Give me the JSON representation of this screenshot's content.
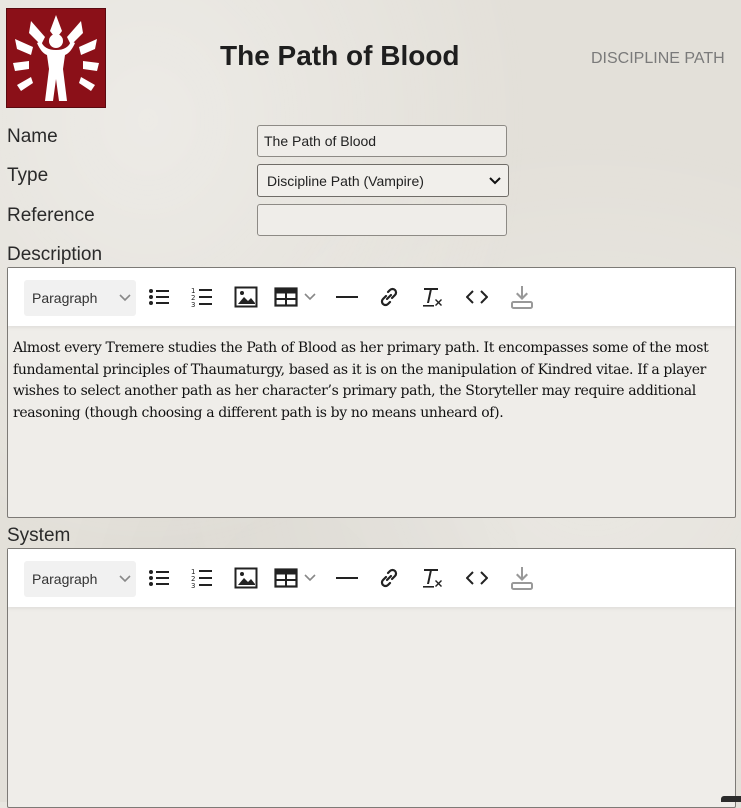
{
  "header": {
    "title": "The Path of Blood",
    "doc_type": "DISCIPLINE PATH",
    "logo_icon": "vampire-figure-flames-icon",
    "logo_color": "#8b1018"
  },
  "form": {
    "name_label": "Name",
    "name_value": "The Path of Blood",
    "type_label": "Type",
    "type_value": "Discipline Path (Vampire)",
    "reference_label": "Reference",
    "reference_value": "",
    "description_label": "Description",
    "system_label": "System"
  },
  "description_editor": {
    "block_format": "Paragraph",
    "toolbar_icons": [
      "bullet-list-icon",
      "numbered-list-icon",
      "image-icon",
      "table-icon",
      "horizontal-rule-icon",
      "link-icon",
      "clear-format-icon",
      "code-icon",
      "download-icon"
    ],
    "content": "Almost every Tremere studies the Path of Blood as her primary path. It encompasses some of the most fundamental principles of Thaumaturgy, based as it is on the manipulation of Kindred vitae. If a player wishes to select another path as her character’s primary path, the Storyteller may require additional reasoning (though choosing a different path is by no means unheard of)."
  },
  "system_editor": {
    "block_format": "Paragraph",
    "toolbar_icons": [
      "bullet-list-icon",
      "numbered-list-icon",
      "image-icon",
      "table-icon",
      "horizontal-rule-icon",
      "link-icon",
      "clear-format-icon",
      "code-icon",
      "download-icon"
    ],
    "content": ""
  }
}
